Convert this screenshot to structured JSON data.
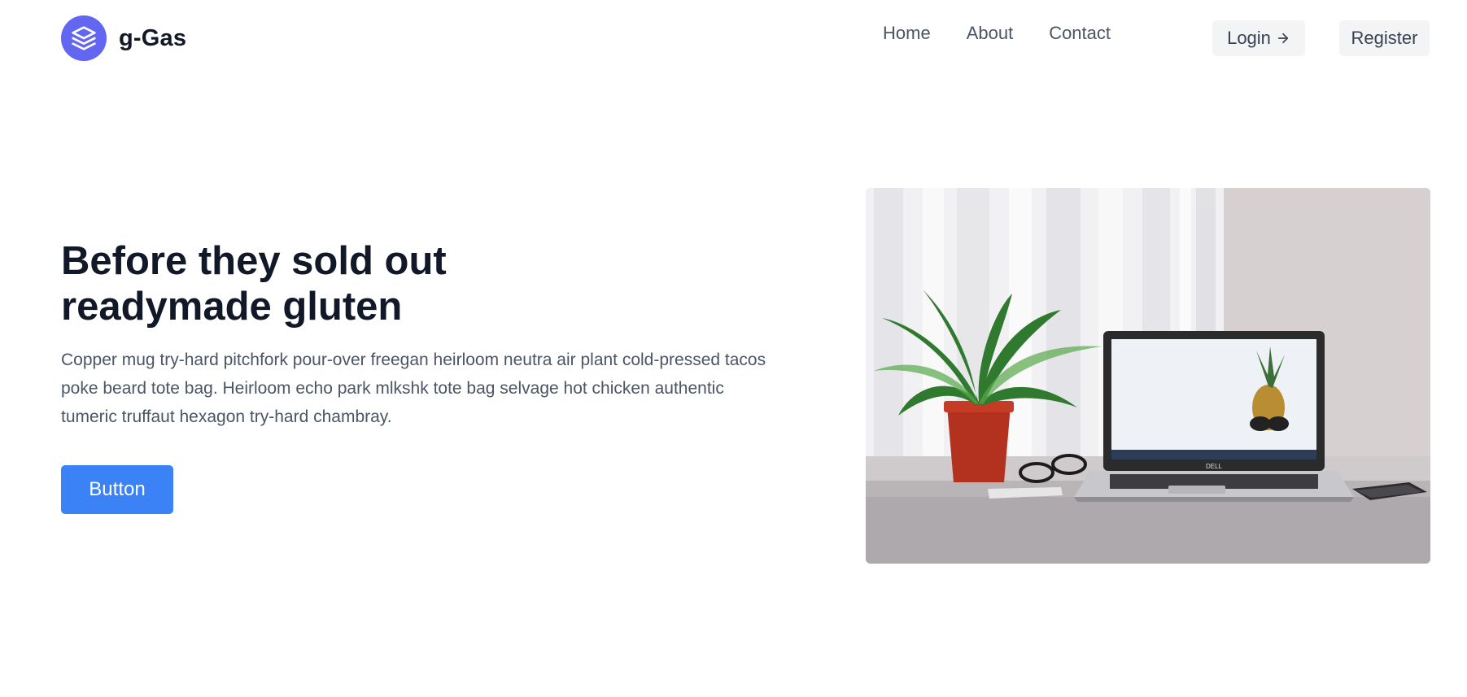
{
  "header": {
    "brand": {
      "name": "g-Gas",
      "logo_icon": "layers-icon",
      "logo_color": "#6366f1"
    },
    "nav": [
      {
        "label": "Home"
      },
      {
        "label": "About"
      },
      {
        "label": "Contact"
      }
    ],
    "login_label": "Login",
    "login_icon": "arrow-right-icon",
    "register_label": "Register"
  },
  "hero": {
    "title_line1": "Before they sold out",
    "title_line2": "readymade gluten",
    "description": "Copper mug try-hard pitchfork pour-over freegan heirloom neutra air plant cold-pressed tacos poke beard tote bag. Heirloom echo park mlkshk tote bag selvage hot chicken authentic tumeric truffaut hexagon try-hard chambray.",
    "button_label": "Button",
    "button_color": "#3b82f6",
    "image": {
      "subject": "laptop-desk-photo",
      "laptop_brand": "DELL"
    }
  }
}
